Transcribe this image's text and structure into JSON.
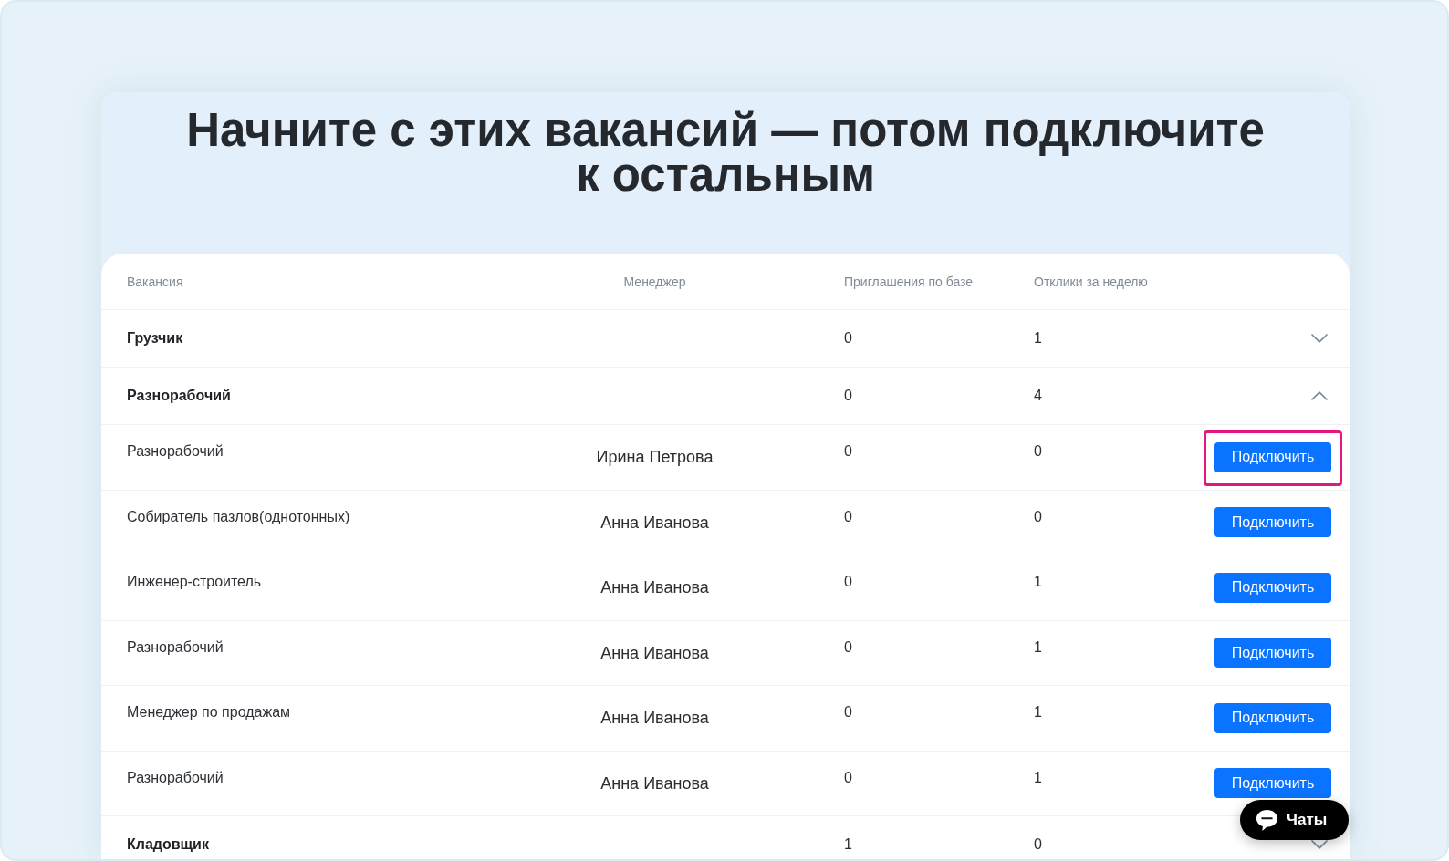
{
  "heading": "Начните с этих вакансий — потом подключите к остальным",
  "table": {
    "columns": [
      "Вакансия",
      "Менеджер",
      "Приглашения по базе",
      "Отклики за неделю"
    ],
    "groups": [
      {
        "title": "Грузчик",
        "invitations": "0",
        "responses": "1",
        "expanded": false
      },
      {
        "title": "Разнорабочий",
        "invitations": "0",
        "responses": "4",
        "expanded": true,
        "children": [
          {
            "vacancy": "Разнорабочий",
            "manager": "Ирина Петрова",
            "invitations": "0",
            "responses": "0",
            "action": "Подключить",
            "highlighted": true
          },
          {
            "vacancy": "Собиратель пазлов(однотонных)",
            "manager": "Анна Иванова",
            "invitations": "0",
            "responses": "0",
            "action": "Подключить",
            "highlighted": false
          },
          {
            "vacancy": "Инженер-строитель",
            "manager": "Анна Иванова",
            "invitations": "0",
            "responses": "1",
            "action": "Подключить",
            "highlighted": false
          },
          {
            "vacancy": "Разнорабочий",
            "manager": "Анна Иванова",
            "invitations": "0",
            "responses": "1",
            "action": "Подключить",
            "highlighted": false
          },
          {
            "vacancy": "Менеджер по продажам",
            "manager": "Анна Иванова",
            "invitations": "0",
            "responses": "1",
            "action": "Подключить",
            "highlighted": false
          },
          {
            "vacancy": "Разнорабочий",
            "manager": "Анна Иванова",
            "invitations": "0",
            "responses": "1",
            "action": "Подключить",
            "highlighted": false
          }
        ]
      },
      {
        "title": "Кладовщик",
        "invitations": "1",
        "responses": "0",
        "expanded": false
      }
    ]
  },
  "chat_button": {
    "label": "Чаты"
  }
}
